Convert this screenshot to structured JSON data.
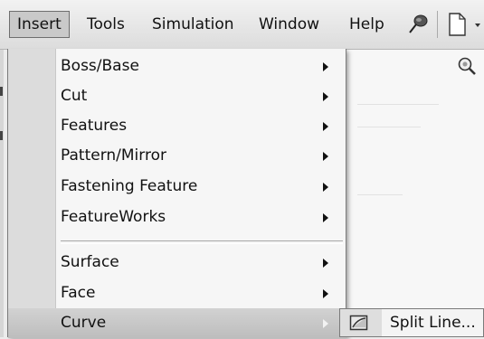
{
  "menubar": {
    "items": [
      {
        "label": "Insert",
        "active": true
      },
      {
        "label": "Tools"
      },
      {
        "label": "Simulation"
      },
      {
        "label": "Window"
      },
      {
        "label": "Help"
      }
    ],
    "icons": [
      "pushpin-icon",
      "new-document-icon",
      "dropdown-arrow-icon"
    ]
  },
  "canvas": {
    "icons": [
      "zoom-icon"
    ]
  },
  "insert_menu": {
    "items": [
      {
        "label": "Boss/Base",
        "submenu": true
      },
      {
        "label": "Cut",
        "submenu": true
      },
      {
        "label": "Features",
        "submenu": true
      },
      {
        "label": "Pattern/Mirror",
        "submenu": true
      },
      {
        "label": "Fastening Feature",
        "submenu": true
      },
      {
        "label": "FeatureWorks",
        "submenu": true
      },
      {
        "label": "Surface",
        "submenu": true
      },
      {
        "label": "Face",
        "submenu": true
      },
      {
        "label": "Curve",
        "submenu": true,
        "highlighted": true
      }
    ]
  },
  "curve_submenu": {
    "items": [
      {
        "label": "Split Line...",
        "icon": "split-line-icon"
      }
    ]
  },
  "colors": {
    "menubar_bg": "#e6e6e6",
    "menu_bg": "#f6f6f6",
    "gutter": "#dcdcdc",
    "highlight": "#c8c8c8"
  }
}
